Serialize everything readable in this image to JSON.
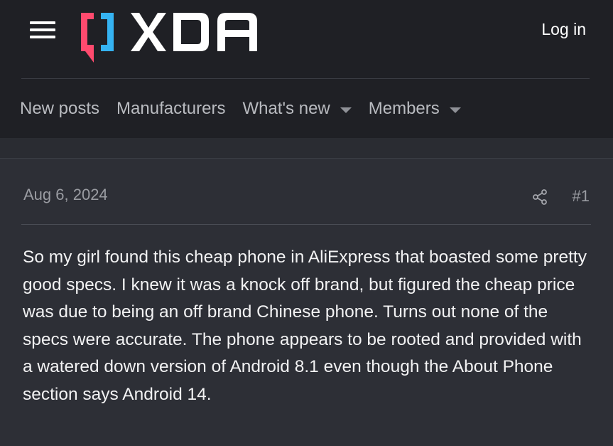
{
  "header": {
    "brand": "XDA",
    "login_label": "Log in",
    "colors": {
      "background": "#1f2025",
      "brand_bracket_left": "#ff4a6e",
      "brand_bracket_right": "#35b3f2",
      "brand_text": "#ffffff"
    }
  },
  "nav": {
    "items": [
      {
        "label": "New posts",
        "has_dropdown": false
      },
      {
        "label": "Manufacturers",
        "has_dropdown": false
      },
      {
        "label": "What's new",
        "has_dropdown": true
      },
      {
        "label": "Members",
        "has_dropdown": true
      }
    ]
  },
  "post": {
    "date": "Aug 6, 2024",
    "number": "#1",
    "body": "So my girl found this cheap phone in AliExpress that boasted some pretty good specs. I knew it was a knock off brand, but figured the cheap price was due to being an off brand Chinese phone. Turns out none of the specs were accurate. The phone appears to be rooted and provided with a watered down version of Android 8.1 even though the About Phone section says Android 14."
  }
}
